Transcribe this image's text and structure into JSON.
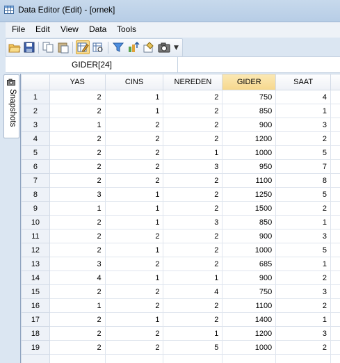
{
  "window": {
    "title": "Data Editor (Edit) - [ornek]"
  },
  "menu": {
    "items": [
      "File",
      "Edit",
      "View",
      "Data",
      "Tools"
    ]
  },
  "toolbar": {
    "buttons": [
      "open-icon",
      "save-icon",
      "copy-icon",
      "paste-icon",
      "edit-mode-icon",
      "browse-mode-icon",
      "filter-icon",
      "variables-icon",
      "properties-icon",
      "snapshot-icon"
    ],
    "active": "edit-mode-icon"
  },
  "cell_reference": "GIDER[24]",
  "side_panel": {
    "label": "Snapshots"
  },
  "grid": {
    "columns": [
      "YAS",
      "CINS",
      "NEREDEN",
      "GIDER",
      "SAAT"
    ],
    "selected_column": "GIDER",
    "rows": [
      [
        "1",
        "2",
        "1",
        "2",
        "750",
        "4"
      ],
      [
        "2",
        "2",
        "1",
        "2",
        "850",
        "1"
      ],
      [
        "3",
        "1",
        "2",
        "2",
        "900",
        "3"
      ],
      [
        "4",
        "2",
        "2",
        "2",
        "1200",
        "2"
      ],
      [
        "5",
        "2",
        "2",
        "1",
        "1000",
        "5"
      ],
      [
        "6",
        "2",
        "2",
        "3",
        "950",
        "7"
      ],
      [
        "7",
        "2",
        "2",
        "2",
        "1100",
        "8"
      ],
      [
        "8",
        "3",
        "1",
        "2",
        "1250",
        "5"
      ],
      [
        "9",
        "1",
        "1",
        "2",
        "1500",
        "2"
      ],
      [
        "10",
        "2",
        "1",
        "3",
        "850",
        "1"
      ],
      [
        "11",
        "2",
        "2",
        "2",
        "900",
        "3"
      ],
      [
        "12",
        "2",
        "1",
        "2",
        "1000",
        "5"
      ],
      [
        "13",
        "3",
        "2",
        "2",
        "685",
        "1"
      ],
      [
        "14",
        "4",
        "1",
        "1",
        "900",
        "2"
      ],
      [
        "15",
        "2",
        "2",
        "4",
        "750",
        "3"
      ],
      [
        "16",
        "1",
        "2",
        "2",
        "1100",
        "2"
      ],
      [
        "17",
        "2",
        "1",
        "2",
        "1400",
        "1"
      ],
      [
        "18",
        "2",
        "2",
        "1",
        "1200",
        "3"
      ],
      [
        "19",
        "2",
        "2",
        "5",
        "1000",
        "2"
      ]
    ]
  }
}
